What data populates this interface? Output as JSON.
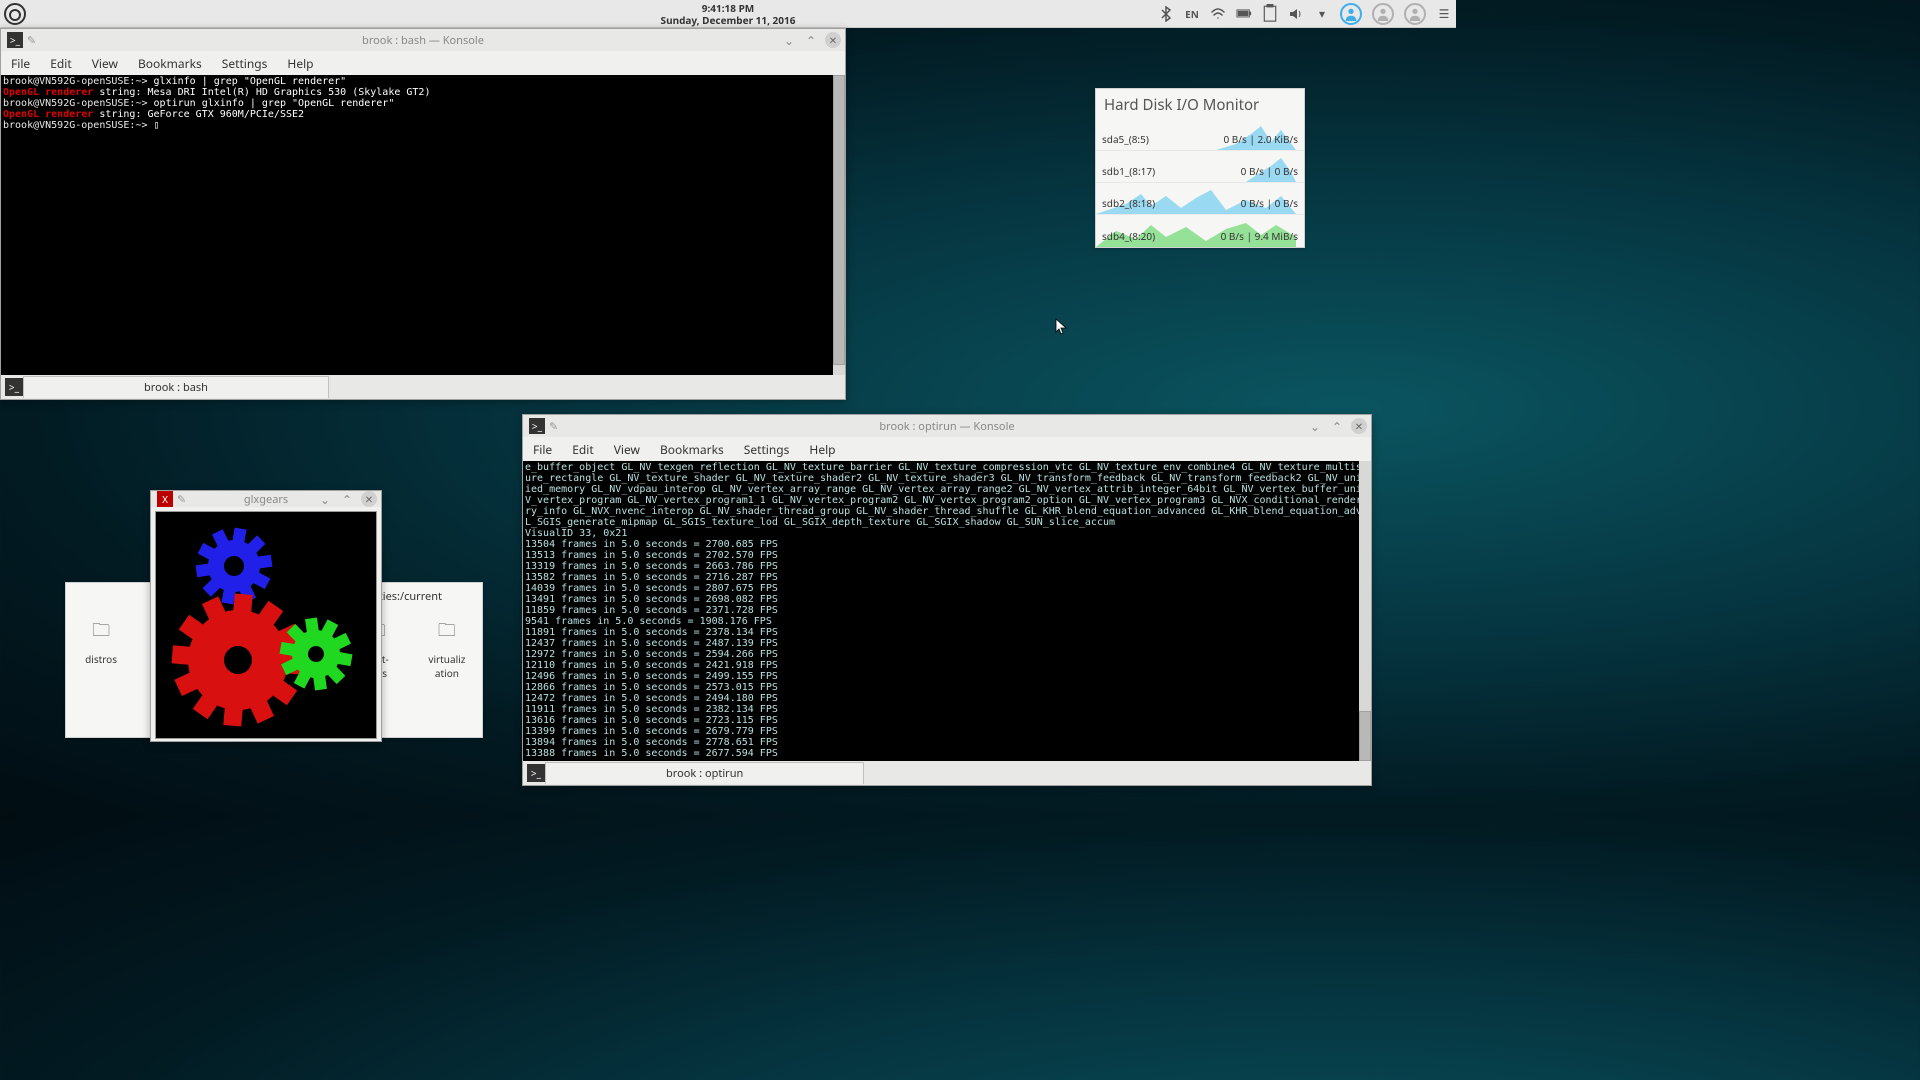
{
  "panel": {
    "time": "9:41:18 PM",
    "date": "Sunday, December 11, 2016",
    "lang": "EN"
  },
  "konsole1": {
    "title": "brook : bash — Konsole",
    "menu": [
      "File",
      "Edit",
      "View",
      "Bookmarks",
      "Settings",
      "Help"
    ],
    "tab": "brook : bash",
    "lines": {
      "prompt": "brook@VN592G-openSUSE:~>",
      "cmd1": "glxinfo | grep \"OpenGL renderer\"",
      "gl_lbl": "OpenGL renderer",
      "out1": " string: Mesa DRI Intel(R) HD Graphics 530 (Skylake GT2)",
      "cmd2": "optirun glxinfo | grep \"OpenGL renderer\"",
      "out2": " string: GeForce GTX 960M/PCIe/SSE2"
    }
  },
  "glxgears": {
    "title": "glxgears"
  },
  "konsole2": {
    "title": "brook : optirun — Konsole",
    "menu": [
      "File",
      "Edit",
      "View",
      "Bookmarks",
      "Settings",
      "Help"
    ],
    "tab": "brook : optirun",
    "ext_dump": "e_buffer_object GL_NV_texgen_reflection GL_NV_texture_barrier GL_NV_texture_compression_vtc GL_NV_texture_env_combine4 GL_NV_texture_multisample GL_NV_text\nure_rectangle GL_NV_texture_shader GL_NV_texture_shader2 GL_NV_texture_shader3 GL_NV_transform_feedback GL_NV_transform_feedback2 GL_NV_uniform_buffer_unif\nied_memory GL_NV_vdpau_interop GL_NV_vertex_array_range GL_NV_vertex_array_range2 GL_NV_vertex_attrib_integer_64bit GL_NV_vertex_buffer_unified_memory GL_N\nV_vertex_program GL_NV_vertex_program1_1 GL_NV_vertex_program2 GL_NV_vertex_program2_option GL_NV_vertex_program3 GL_NVX_conditional_render GL_NVX_gpu_memo\nry_info GL_NVX_nvenc_interop GL_NV_shader_thread_group GL_NV_shader_thread_shuffle GL_KHR_blend_equation_advanced GL_KHR_blend_equation_advanced_coherent G\nL_SGIS_generate_mipmap GL_SGIS_texture_lod GL_SGIX_depth_texture GL_SGIX_shadow GL_SUN_slice_accum",
    "visual": "VisualID 33, 0x21",
    "fps": [
      "13504 frames in 5.0 seconds = 2700.685 FPS",
      "13513 frames in 5.0 seconds = 2702.570 FPS",
      "13319 frames in 5.0 seconds = 2663.786 FPS",
      "13582 frames in 5.0 seconds = 2716.287 FPS",
      "14039 frames in 5.0 seconds = 2807.675 FPS",
      "13491 frames in 5.0 seconds = 2698.082 FPS",
      "11859 frames in 5.0 seconds = 2371.728 FPS",
      "9541 frames in 5.0 seconds = 1908.176 FPS",
      "11891 frames in 5.0 seconds = 2378.134 FPS",
      "12437 frames in 5.0 seconds = 2487.139 FPS",
      "12972 frames in 5.0 seconds = 2594.266 FPS",
      "12110 frames in 5.0 seconds = 2421.918 FPS",
      "12496 frames in 5.0 seconds = 2499.155 FPS",
      "12866 frames in 5.0 seconds = 2573.015 FPS",
      "12472 frames in 5.0 seconds = 2494.180 FPS",
      "11911 frames in 5.0 seconds = 2382.134 FPS",
      "13616 frames in 5.0 seconds = 2723.115 FPS",
      "13399 frames in 5.0 seconds = 2679.779 FPS",
      "13894 frames in 5.0 seconds = 2778.651 FPS",
      "13388 frames in 5.0 seconds = 2677.594 FPS"
    ]
  },
  "disk": {
    "title": "Hard Disk I/O Monitor",
    "rows": [
      {
        "label": "sda5_(8:5)",
        "rate": "0 B/s | 2.0 KiB/s"
      },
      {
        "label": "sdb1_(8:17)",
        "rate": "0 B/s | 0 B/s"
      },
      {
        "label": "sdb2_(8:18)",
        "rate": "0 B/s | 0 B/s"
      },
      {
        "label": "sdb4_(8:20)",
        "rate": "0 B/s | 9.4 MiB/s"
      }
    ]
  },
  "folderview": {
    "path": "vities:/current",
    "items": [
      "distros",
      "duct-\niews",
      "virtualiz\nation"
    ]
  }
}
